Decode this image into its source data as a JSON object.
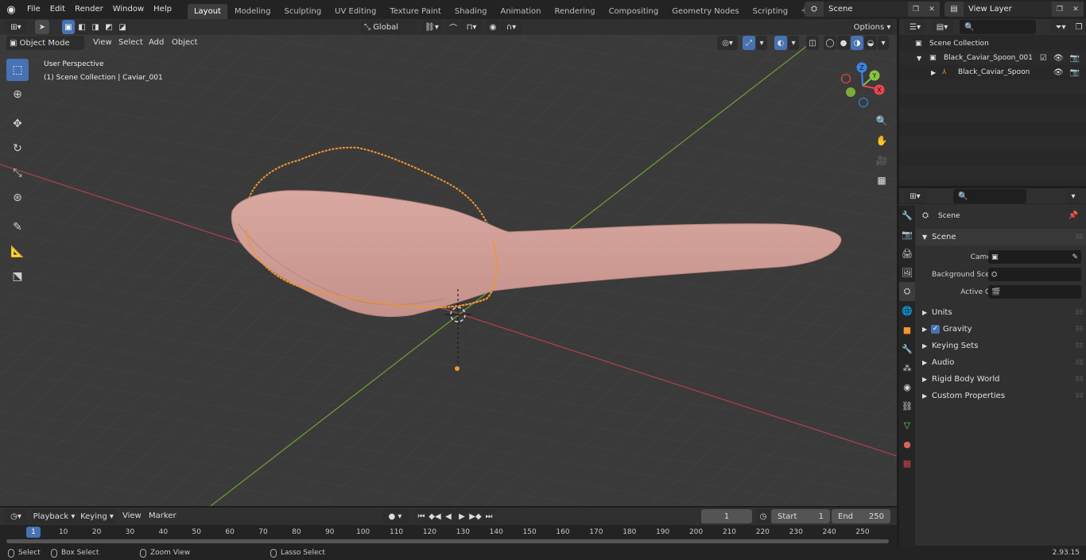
{
  "topbar": {
    "menus": [
      "File",
      "Edit",
      "Render",
      "Window",
      "Help"
    ],
    "workspaces": [
      "Layout",
      "Modeling",
      "Sculpting",
      "UV Editing",
      "Texture Paint",
      "Shading",
      "Animation",
      "Rendering",
      "Compositing",
      "Geometry Nodes",
      "Scripting"
    ],
    "active_workspace": "Layout",
    "scene_name": "Scene",
    "view_layer": "View Layer"
  },
  "viewport_header": {
    "mode": "Object Mode",
    "menus": [
      "View",
      "Select",
      "Add",
      "Object"
    ],
    "orientation": "Global",
    "options_label": "Options"
  },
  "viewport": {
    "perspective_label": "User Perspective",
    "collection_label": "(1) Scene Collection | Caviar_001",
    "axis_colors": {
      "x": "#e8454e",
      "y": "#8ac43f",
      "z": "#3b83e6"
    },
    "gizmo_labels": {
      "x": "X",
      "y": "Y",
      "z": "Z"
    }
  },
  "outliner": {
    "search_placeholder": "",
    "items": [
      {
        "label": "Scene Collection"
      },
      {
        "label": "Black_Caviar_Spoon_001"
      },
      {
        "label": "Black_Caviar_Spoon"
      }
    ]
  },
  "properties": {
    "context_label": "Scene",
    "section_title": "Scene",
    "fields": [
      {
        "label": "Camera",
        "value": ""
      },
      {
        "label": "Background Scene",
        "value": ""
      },
      {
        "label": "Active Clip",
        "value": ""
      }
    ],
    "panels": [
      "Units",
      "Gravity",
      "Keying Sets",
      "Audio",
      "Rigid Body World",
      "Custom Properties"
    ]
  },
  "timeline": {
    "menus": [
      "Playback",
      "Keying",
      "View",
      "Marker"
    ],
    "current_frame": "1",
    "start_label": "Start",
    "start_value": "1",
    "end_label": "End",
    "end_value": "250",
    "ruler": [
      "1",
      "10",
      "20",
      "30",
      "40",
      "50",
      "60",
      "70",
      "80",
      "90",
      "100",
      "110",
      "120",
      "130",
      "140",
      "150",
      "160",
      "170",
      "180",
      "190",
      "200",
      "210",
      "220",
      "230",
      "240",
      "250"
    ]
  },
  "statusbar": {
    "items": [
      "Select",
      "Box Select",
      "Zoom View",
      "Lasso Select"
    ],
    "version": "2.93.15"
  }
}
